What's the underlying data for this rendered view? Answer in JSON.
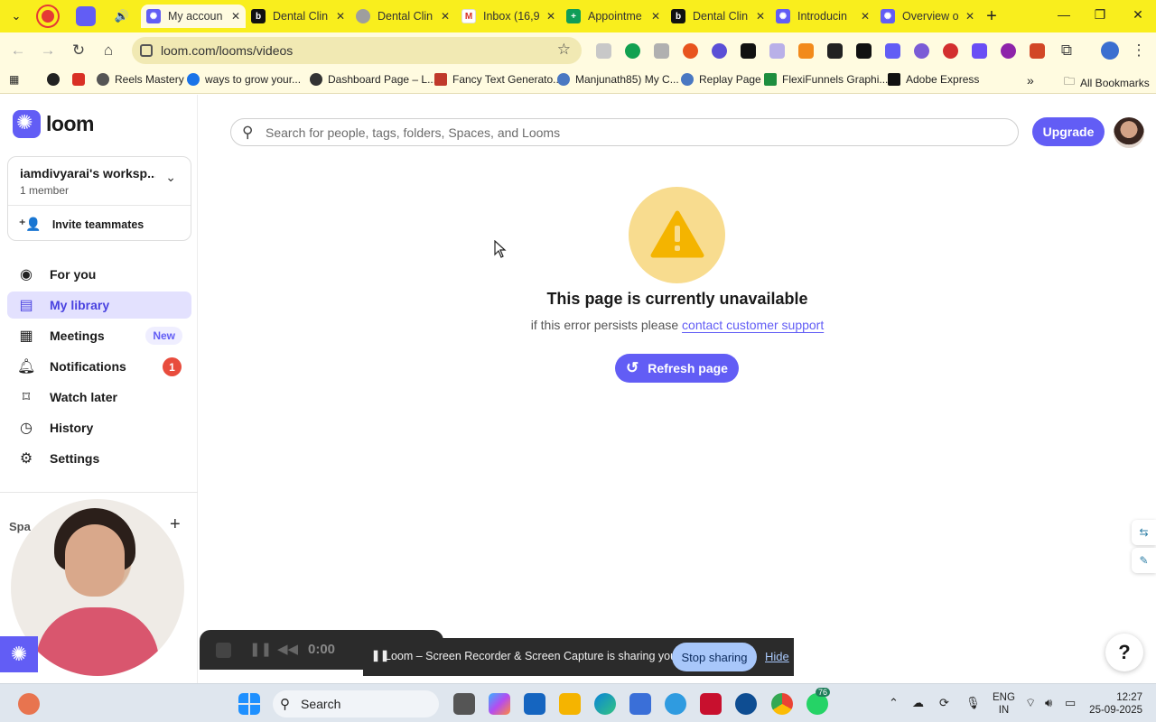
{
  "browser": {
    "tabs": [
      {
        "title": "My accoun",
        "active": true
      },
      {
        "title": "Dental Clin"
      },
      {
        "title": "Dental Clin"
      },
      {
        "title": "Inbox (16,9"
      },
      {
        "title": "Appointme"
      },
      {
        "title": "Dental Clin"
      },
      {
        "title": "Introducin"
      },
      {
        "title": "Overview o"
      }
    ],
    "url": "loom.com/looms/videos",
    "bookmarks": [
      "Reels Mastery",
      "ways to grow your...",
      "Dashboard Page – L...",
      "Fancy Text Generato...",
      "Manjunath85) My C...",
      "Replay Page",
      "FlexiFunnels Graphi...",
      "Adobe Express"
    ],
    "all_bookmarks": "All Bookmarks"
  },
  "sidebar": {
    "brand": "loom",
    "workspace_name": "iamdivyarai's worksp...",
    "workspace_members": "1 member",
    "invite_label": "Invite teammates",
    "nav": [
      {
        "label": "For you",
        "icon": "person-icon"
      },
      {
        "label": "My library",
        "icon": "library-icon",
        "active": true
      },
      {
        "label": "Meetings",
        "icon": "calendar-icon",
        "badge": "New"
      },
      {
        "label": "Notifications",
        "icon": "bell-icon",
        "count": "1"
      },
      {
        "label": "Watch later",
        "icon": "bookmark-icon"
      },
      {
        "label": "History",
        "icon": "clock-icon"
      },
      {
        "label": "Settings",
        "icon": "gear-icon"
      }
    ],
    "spaces_label": "Spa"
  },
  "header": {
    "search_placeholder": "Search for people, tags, folders, Spaces, and Looms",
    "upgrade_label": "Upgrade"
  },
  "error": {
    "title": "This page is currently unavailable",
    "subtitle_prefix": "if this error persists please",
    "support_link": "contact customer support",
    "refresh_label": "Refresh page"
  },
  "recorder": {
    "time": "0:00"
  },
  "share_notice": {
    "text": "Loom – Screen Recorder & Screen Capture is sharing your screen.",
    "stop_label": "Stop sharing",
    "hide_label": "Hide"
  },
  "taskbar": {
    "search_label": "Search",
    "badge_count": "76",
    "lang_line1": "ENG",
    "lang_line2": "IN",
    "time": "12:27",
    "date": "25-09-2025"
  },
  "colors": {
    "accent": "#625df5",
    "chrome_theme": "#f9ee1d",
    "warning": "#f8dc8f"
  }
}
